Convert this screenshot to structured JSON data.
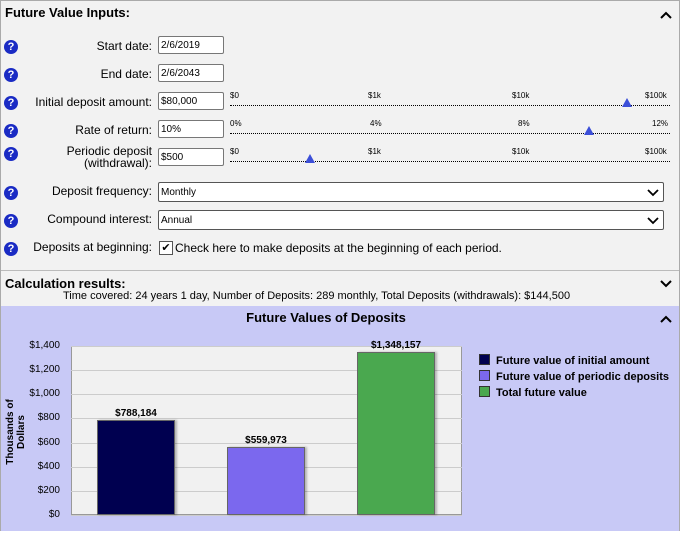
{
  "inputs": {
    "title": "Future Value Inputs:",
    "start_date": {
      "label": "Start date:",
      "value": "2/6/2019"
    },
    "end_date": {
      "label": "End date:",
      "value": "2/6/2043"
    },
    "initial_deposit": {
      "label": "Initial deposit amount:",
      "value": "$80,000",
      "ticks": [
        "$0",
        "$1k",
        "$10k",
        "$100k"
      ]
    },
    "rate_of_return": {
      "label": "Rate of return:",
      "value": "10%",
      "ticks": [
        "0%",
        "4%",
        "8%",
        "12%"
      ]
    },
    "periodic_deposit": {
      "label_line1": "Periodic deposit",
      "label_line2": "(withdrawal):",
      "value": "$500",
      "ticks": [
        "$0",
        "$1k",
        "$10k",
        "$100k"
      ]
    },
    "deposit_frequency": {
      "label": "Deposit frequency:",
      "value": "Monthly"
    },
    "compound_interest": {
      "label": "Compound interest:",
      "value": "Annual"
    },
    "deposits_at_beginning": {
      "label": "Deposits at beginning:",
      "checked": true,
      "text": "Check here to make deposits at the beginning of each period."
    },
    "help_glyph": "?"
  },
  "results": {
    "title": "Calculation results:",
    "summary": "Time covered: 24 years 1 day, Number of Deposits: 289 monthly, Total Deposits (withdrawals): $144,500"
  },
  "chart": {
    "title": "Future Values of Deposits",
    "ylabel": "Thousands of Dollars"
  },
  "chart_data": {
    "type": "bar",
    "categories": [
      "Future value of initial amount",
      "Future value of periodic deposits",
      "Total future value"
    ],
    "values": [
      788.184,
      559.973,
      1348.157
    ],
    "value_labels": [
      "$788,184",
      "$559,973",
      "$1,348,157"
    ],
    "colors": [
      "#000050",
      "#7b68ee",
      "#4aa84f"
    ],
    "ylim": [
      0,
      1400
    ],
    "yticks": [
      "$0",
      "$200",
      "$400",
      "$600",
      "$800",
      "$1,000",
      "$1,200",
      "$1,400"
    ],
    "ylabel": "Thousands of Dollars",
    "grid": true,
    "legend": "right",
    "legend_entries": [
      "Future value of initial amount",
      "Future value of periodic deposits",
      "Total future value"
    ]
  }
}
